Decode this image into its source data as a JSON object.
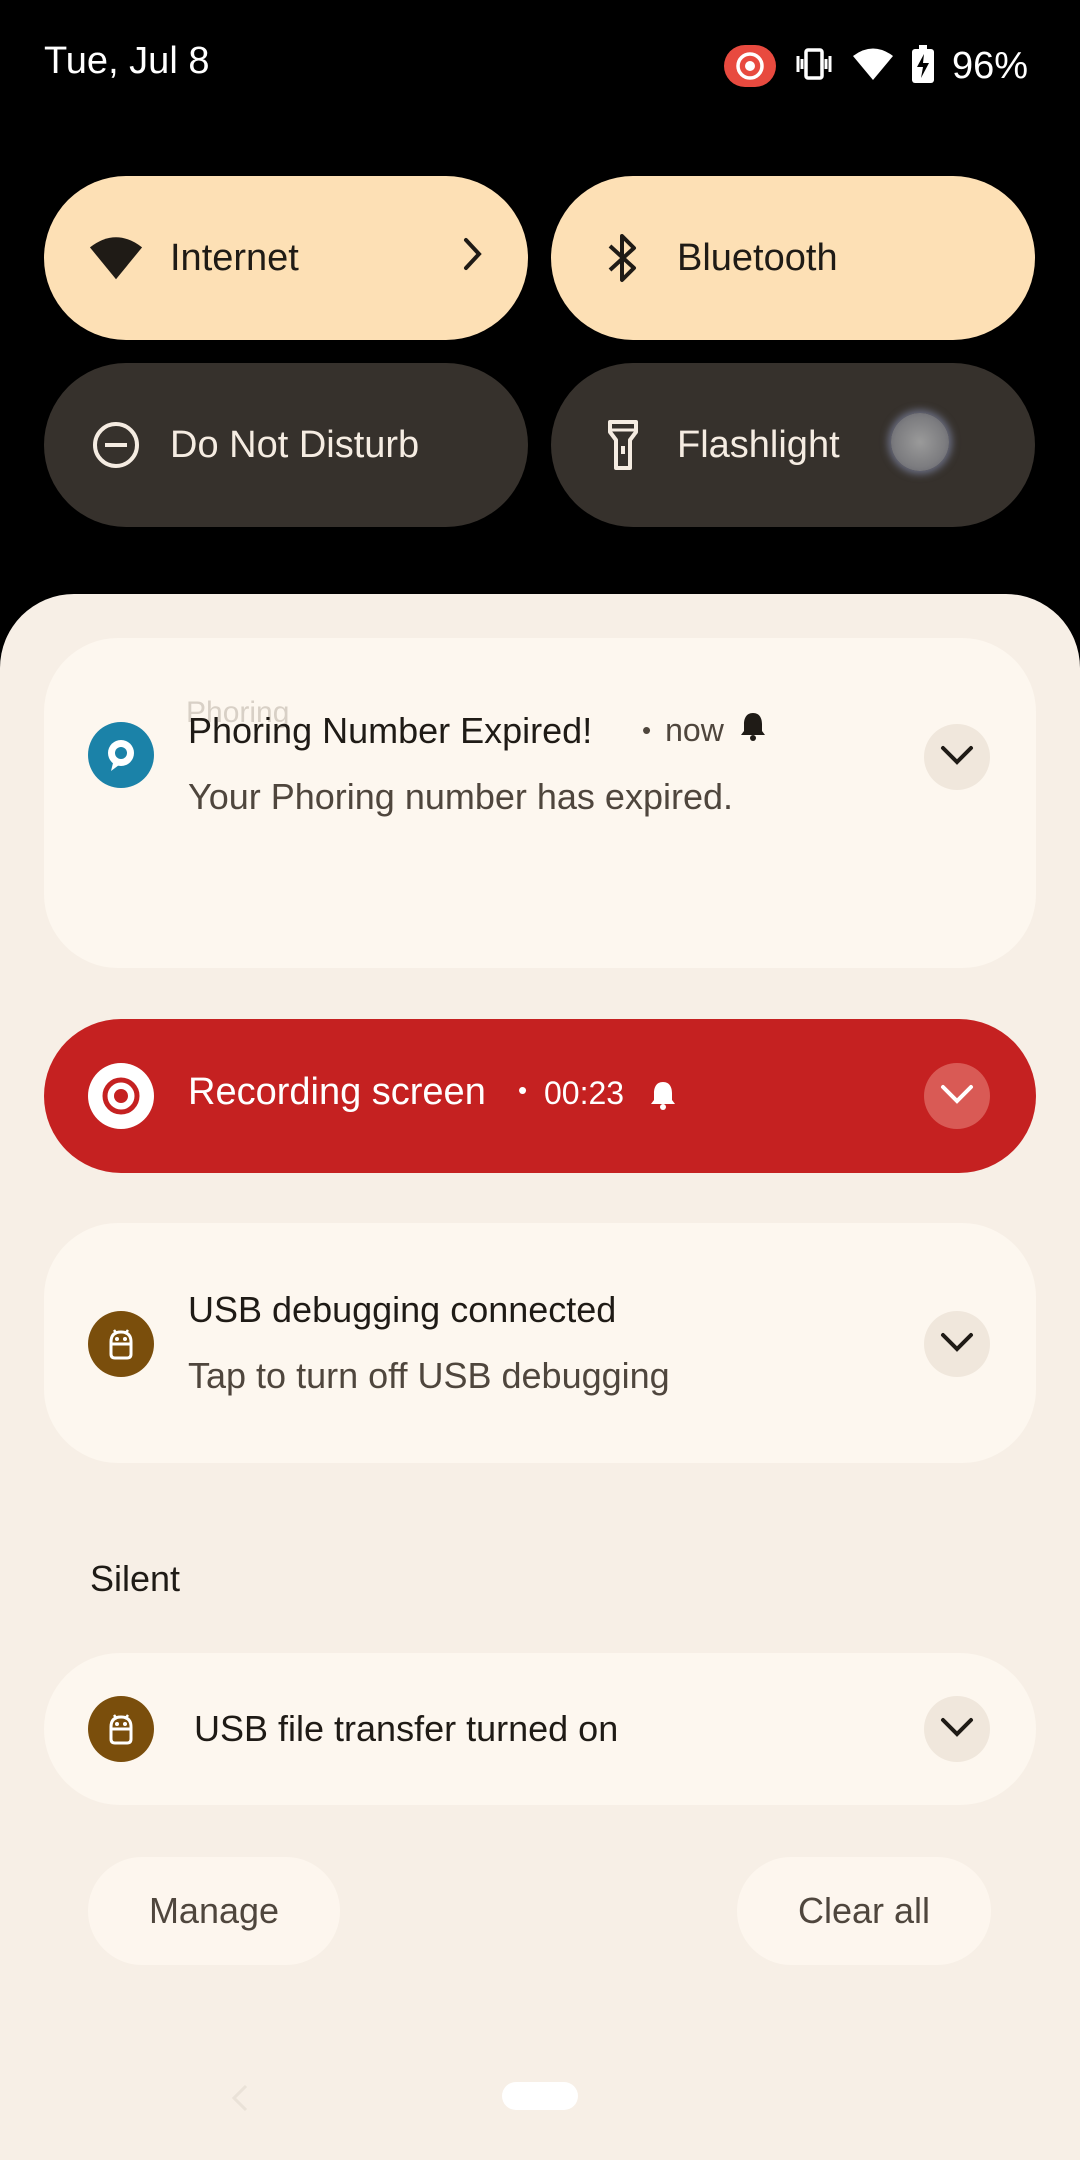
{
  "status_bar": {
    "date": "Tue, Jul 8",
    "battery": "96%",
    "icons": [
      "screen-record-icon",
      "vibrate-icon",
      "wifi-icon",
      "battery-charging-icon"
    ]
  },
  "quick_settings": {
    "tiles": [
      {
        "label": "Internet",
        "icon": "wifi-icon",
        "state": "on",
        "has_chevron": true
      },
      {
        "label": "Bluetooth",
        "icon": "bluetooth-icon",
        "state": "on"
      },
      {
        "label": "Do Not Disturb",
        "icon": "do-not-disturb-icon",
        "state": "off"
      },
      {
        "label": "Flashlight",
        "icon": "flashlight-icon",
        "state": "off"
      }
    ]
  },
  "notifications": {
    "phoring": {
      "app_name": "Phoring",
      "title": "Phoring Number Expired!",
      "time": "now",
      "text": "Your Phoring number has expired."
    },
    "recording": {
      "title": "Recording screen",
      "time": "00:23"
    },
    "usb_debug": {
      "title": "USB debugging connected",
      "text": "Tap to turn off USB debugging"
    },
    "section_label": "Silent",
    "usb_transfer": {
      "title": "USB file transfer turned on"
    }
  },
  "actions": {
    "manage": "Manage",
    "clear_all": "Clear all"
  },
  "colors": {
    "tile_on": "#fde0b5",
    "tile_off": "#36312c",
    "recording": "#c52121",
    "phoring_icon": "#1b82a8",
    "usb_icon": "#7a4e0c"
  }
}
